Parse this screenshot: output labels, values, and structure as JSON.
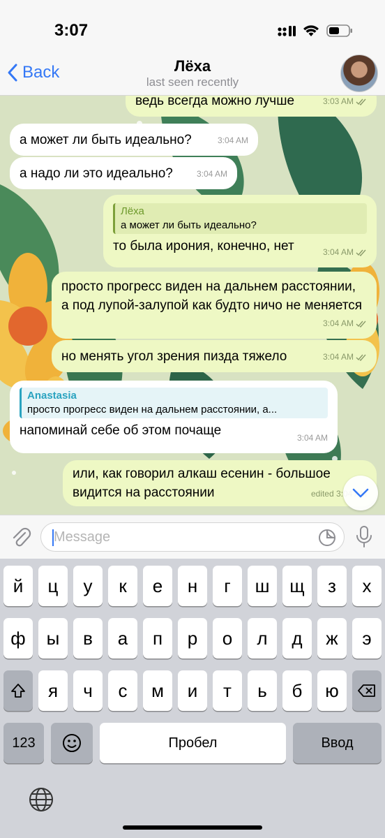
{
  "status_bar": {
    "time": "3:07"
  },
  "header": {
    "back_label": "Back",
    "contact_name": "Лёха",
    "contact_status": "last seen recently"
  },
  "messages": [
    {
      "direction": "out",
      "text": "ведь всегда можно лучше",
      "time": "3:03 AM",
      "read": true
    },
    {
      "direction": "in",
      "text": "а может ли быть идеально?",
      "time": "3:04 AM"
    },
    {
      "direction": "in",
      "text": "а надо ли это идеально?",
      "time": "3:04 AM"
    },
    {
      "direction": "out",
      "reply_name": "Лёха",
      "reply_text": "а может ли быть идеально?",
      "text": "то была ирония, конечно, нет",
      "time": "3:04 AM",
      "read": true
    },
    {
      "direction": "out",
      "text": "просто прогресс виден на дальнем расстоянии, а под лупой-залупой как будто ничо не меняется",
      "time": "3:04 AM",
      "read": true
    },
    {
      "direction": "out",
      "text": "но менять угол зрения пизда тяжело",
      "time": "3:04 AM",
      "read": true
    },
    {
      "direction": "in",
      "reply_name": "Anastasia",
      "reply_text": "просто прогресс виден на дальнем расстоянии, а...",
      "text": "напоминай себе об этом почаще",
      "time": "3:04 AM"
    },
    {
      "direction": "out",
      "text": "или, как говорил алкаш есенин - большое видится на расстоянии",
      "time": "edited 3:04 AM"
    }
  ],
  "composer": {
    "placeholder": "Message"
  },
  "keyboard": {
    "row1": [
      "й",
      "ц",
      "у",
      "к",
      "е",
      "н",
      "г",
      "ш",
      "щ",
      "з",
      "х"
    ],
    "row2": [
      "ф",
      "ы",
      "в",
      "а",
      "п",
      "р",
      "о",
      "л",
      "д",
      "ж",
      "э"
    ],
    "row3": [
      "я",
      "ч",
      "с",
      "м",
      "и",
      "т",
      "ь",
      "б",
      "ю"
    ],
    "numbers_key": "123",
    "space_label": "Пробел",
    "return_label": "Ввод"
  },
  "colors": {
    "accent": "#3478f6",
    "outgoing_bubble": "#eef8c4",
    "incoming_bubble": "#ffffff",
    "reply_accent": "#2aa3c0",
    "reply_accent_out": "#7da03a"
  }
}
